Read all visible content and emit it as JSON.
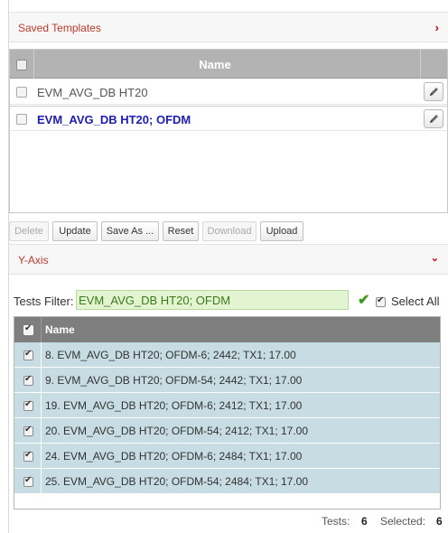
{
  "saved_templates": {
    "title": "Saved Templates",
    "chevron": "›",
    "column_name": "Name",
    "rows": [
      {
        "name": "EVM_AVG_DB HT20",
        "active": false,
        "edit_icon": "pencil-icon"
      },
      {
        "name": "EVM_AVG_DB HT20; OFDM",
        "active": true,
        "edit_icon": "pencil-icon"
      }
    ],
    "buttons": {
      "delete": "Delete",
      "update": "Update",
      "save_as": "Save As ...",
      "reset": "Reset",
      "download": "Download",
      "upload": "Upload"
    }
  },
  "y_axis": {
    "title": "Y-Axis",
    "chevron": "⌄",
    "filter_label": "Tests Filter:",
    "filter_value": "EVM_AVG_DB HT20; OFDM",
    "check_icon": "checkmark-icon",
    "select_all_label": "Select All",
    "column_name": "Name",
    "tests": [
      "8. EVM_AVG_DB HT20; OFDM-6; 2442; TX1; 17.00",
      "9. EVM_AVG_DB HT20; OFDM-54; 2442; TX1; 17.00",
      "19. EVM_AVG_DB HT20; OFDM-6; 2412; TX1; 17.00",
      "20. EVM_AVG_DB HT20; OFDM-54; 2412; TX1; 17.00",
      "24. EVM_AVG_DB HT20; OFDM-6; 2484; TX1; 17.00",
      "25. EVM_AVG_DB HT20; OFDM-54; 2484; TX1; 17.00"
    ],
    "footer": {
      "tests_label": "Tests:",
      "tests_count": "6",
      "selected_label": "Selected:",
      "selected_count": "6"
    }
  },
  "colors": {
    "accent_red": "#d0021b",
    "active_link": "#1d1db5",
    "filter_bg": "#e3f5d0",
    "row_bg": "#c7dde3",
    "header_gray": "#7e7e7e"
  }
}
